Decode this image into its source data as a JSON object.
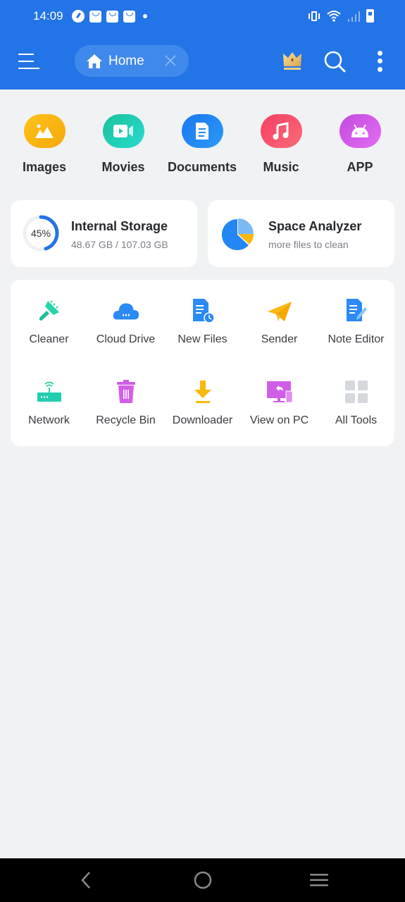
{
  "status_bar": {
    "time": "14:09",
    "left_icons": [
      "speedometer-icon",
      "shopping-bag-icon",
      "shopping-bag-icon",
      "shopping-bag-icon",
      "dot-icon"
    ],
    "right_icons": [
      "vibrate-icon",
      "wifi-icon",
      "signal-icon",
      "battery-icon"
    ]
  },
  "app_bar": {
    "menu_icon": "hamburger-menu-icon",
    "tab": {
      "label": "Home",
      "icon": "home-icon",
      "close_icon": "close-icon"
    },
    "actions": [
      "crown-premium-icon",
      "search-icon",
      "more-vert-icon"
    ]
  },
  "categories": [
    {
      "label": "Images",
      "icon": "image-icon",
      "color": "#fbb90f"
    },
    {
      "label": "Movies",
      "icon": "video-icon",
      "color": "#1ec9b0"
    },
    {
      "label": "Documents",
      "icon": "document-icon",
      "color": "#2286f5"
    },
    {
      "label": "Music",
      "icon": "music-note-icon",
      "color": "#f54a6a"
    },
    {
      "label": "APP",
      "icon": "android-icon",
      "color": "#d05de8"
    }
  ],
  "storage": {
    "title": "Internal Storage",
    "used_percent_label": "45%",
    "used_fraction": 0.45,
    "usage": "48.67 GB / 107.03 GB"
  },
  "analyzer": {
    "title": "Space Analyzer",
    "subtitle": "more files to clean"
  },
  "tools": [
    {
      "label": "Cleaner",
      "icon": "brush-icon"
    },
    {
      "label": "Cloud Drive",
      "icon": "cloud-icon"
    },
    {
      "label": "New Files",
      "icon": "new-files-icon"
    },
    {
      "label": "Sender",
      "icon": "paper-plane-icon"
    },
    {
      "label": "Note Editor",
      "icon": "note-edit-icon"
    },
    {
      "label": "Network",
      "icon": "router-icon"
    },
    {
      "label": "Recycle Bin",
      "icon": "trash-icon"
    },
    {
      "label": "Downloader",
      "icon": "download-icon"
    },
    {
      "label": "View on PC",
      "icon": "monitor-icon"
    },
    {
      "label": "All Tools",
      "icon": "grid-icon"
    }
  ],
  "nav_bar": [
    "back-icon",
    "home-circle-icon",
    "recents-icon"
  ],
  "colors": {
    "primary": "#2374e6",
    "background": "#f1f2f4"
  }
}
